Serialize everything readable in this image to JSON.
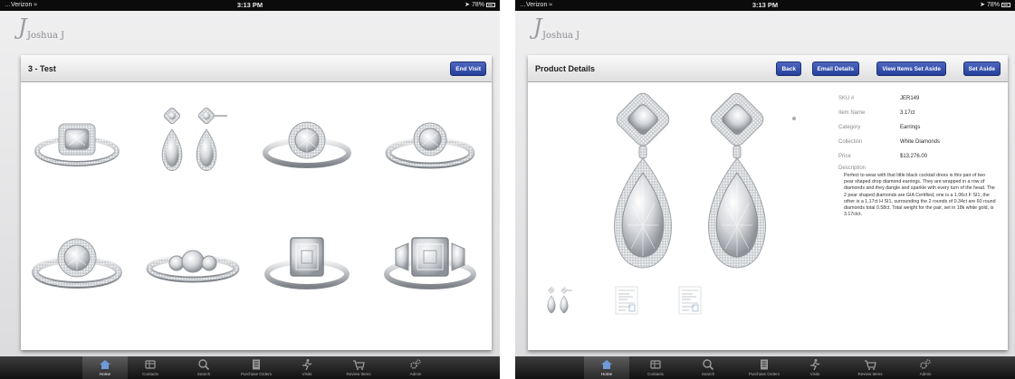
{
  "left_screen": {
    "status": {
      "carrier": "Verizon",
      "time": "3:13 PM",
      "battery": "78%"
    },
    "logo": {
      "monogram": "J",
      "name": "Joshua J"
    },
    "header": {
      "title": "3 - Test",
      "end_visit_label": "End Visit"
    },
    "products": [
      {
        "type": "ring-cushion-halo"
      },
      {
        "type": "earrings-pear-drop"
      },
      {
        "type": "ring-round-halo"
      },
      {
        "type": "ring-round-pave"
      },
      {
        "type": "ring-round-halo-split"
      },
      {
        "type": "ring-three-stone"
      },
      {
        "type": "ring-emerald-cut"
      },
      {
        "type": "ring-emerald-three-stone"
      }
    ]
  },
  "right_screen": {
    "status": {
      "carrier": "Verizon",
      "time": "3:13 PM",
      "battery": "78%"
    },
    "logo": {
      "monogram": "J",
      "name": "Joshua J"
    },
    "header": {
      "title": "Product Details",
      "back_label": "Back",
      "email_label": "Email Details",
      "view_aside_label": "View Items Set Aside",
      "set_aside_label": "Set Aside"
    },
    "details": {
      "sku_label": "SKU #",
      "sku": "JER149",
      "item_name_label": "Item Name",
      "item_name": "3.17ct",
      "category_label": "Category",
      "category": "Earrings",
      "collection_label": "Collection",
      "collection": "White Diamonds",
      "price_label": "Price",
      "price": "$13,276.00",
      "description_label": "Description",
      "description": "Perfect to wear with that little black cocktail dress is this pair of two pear shaped drop diamond earrings. They are wrapped in a row of diamonds and they dangle and sparkle with every turn of the head. The 2 pear shaped diamonds are GIA Certified, one is a 1.06ct F SI1, the other is a 1.17ct H SI1, surrounding the 2 rounds of 0.34ct are 60 round diamonds total 0.58ct. Total weight for the pair, set in 18k white gold, is 3.17ctct."
    }
  },
  "tabbar": {
    "tabs": [
      {
        "label": "Home",
        "icon": "home-icon"
      },
      {
        "label": "Contacts",
        "icon": "contacts-icon"
      },
      {
        "label": "Search",
        "icon": "search-icon"
      },
      {
        "label": "Purchase Orders",
        "icon": "purchase-orders-icon"
      },
      {
        "label": "Visits",
        "icon": "visits-icon"
      },
      {
        "label": "Review Items",
        "icon": "cart-icon"
      },
      {
        "label": "Admin",
        "icon": "gears-icon"
      }
    ],
    "active_tab": "Home"
  },
  "colors": {
    "button_blue": "#2d47a3",
    "tab_bar": "#1a1a1a",
    "panel": "#ffffff",
    "background": "#e9e9ea"
  }
}
